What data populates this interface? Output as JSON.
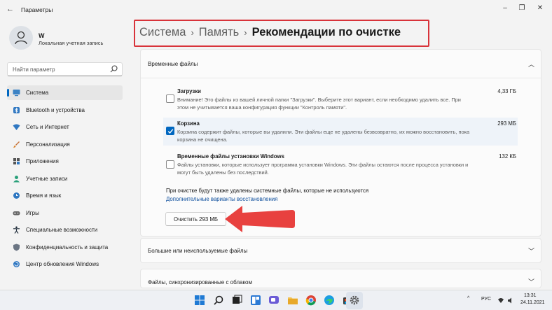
{
  "window": {
    "title": "Параметры"
  },
  "user": {
    "name": "W",
    "account_type": "Локальная учетная запись"
  },
  "search": {
    "placeholder": "Найти параметр"
  },
  "sidebar": {
    "items": [
      {
        "label": "Система",
        "icon": "system-icon"
      },
      {
        "label": "Bluetooth и устройства",
        "icon": "bluetooth-icon"
      },
      {
        "label": "Сеть и Интернет",
        "icon": "network-icon"
      },
      {
        "label": "Персонализация",
        "icon": "brush-icon"
      },
      {
        "label": "Приложения",
        "icon": "apps-icon"
      },
      {
        "label": "Учетные записи",
        "icon": "accounts-icon"
      },
      {
        "label": "Время и язык",
        "icon": "globe-clock-icon"
      },
      {
        "label": "Игры",
        "icon": "gamepad-icon"
      },
      {
        "label": "Специальные возможности",
        "icon": "accessibility-icon"
      },
      {
        "label": "Конфиденциальность и защита",
        "icon": "shield-icon"
      },
      {
        "label": "Центр обновления Windows",
        "icon": "update-icon"
      }
    ]
  },
  "breadcrumb": {
    "part1": "Система",
    "part2": "Память",
    "current": "Рекомендации по очистке"
  },
  "temp_files": {
    "header": "Временные файлы",
    "items": [
      {
        "title": "Загрузки",
        "size": "4,33 ГБ",
        "checked": false,
        "desc1": "Внимание! Это файлы из вашей личной папки \"Загрузки\". Выберите этот вариант, если необходимо удалить все. При",
        "desc2": "этом не учитывается ваша конфигурация функции \"Контроль памяти\"."
      },
      {
        "title": "Корзина",
        "size": "293 МБ",
        "checked": true,
        "desc1": "Корзина содержит файлы, которые вы удалили. Эти файлы еще не удалены безвозвратно, их можно восстановить, пока",
        "desc2": "корзина не очищена."
      },
      {
        "title": "Временные файлы установки Windows",
        "size": "132 КБ",
        "checked": false,
        "desc1": "Файлы установки, которые использует программа установки Windows.  Эти файлы остаются после процесса установки и",
        "desc2": "могут быть удалены без последствий."
      }
    ],
    "note": "При очистке будут также удалены системные файлы, которые не используются",
    "link": "Дополнительные варианты восстановления",
    "button": "Очистить 293 МБ"
  },
  "large_files": {
    "header": "Большие или неиспользуемые файлы"
  },
  "cloud_files": {
    "header": "Файлы, синхронизированные с облаком"
  },
  "taskbar": {
    "lang": "РУС",
    "time": "13:31",
    "date": "24.11.2021"
  },
  "colors": {
    "accent": "#0067c0",
    "highlight_border": "#d8333a",
    "arrow": "#e8413f"
  }
}
